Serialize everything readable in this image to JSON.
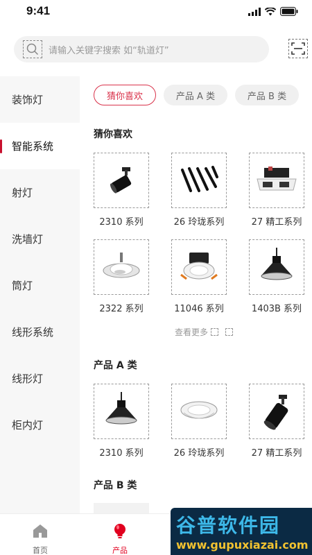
{
  "status_bar": {
    "time": "9:41"
  },
  "search": {
    "placeholder": "请输入关键字搜索 如“轨道灯”"
  },
  "sidebar": {
    "items": [
      {
        "label": "装饰灯"
      },
      {
        "label": "智能系统"
      },
      {
        "label": "射灯"
      },
      {
        "label": "洗墙灯"
      },
      {
        "label": "筒灯"
      },
      {
        "label": "线形系统"
      },
      {
        "label": "线形灯"
      },
      {
        "label": "柜内灯"
      }
    ],
    "active_index": 1
  },
  "chips": [
    {
      "label": "猜你喜欢"
    },
    {
      "label": "产品 A 类"
    },
    {
      "label": "产品 B 类"
    }
  ],
  "sections": {
    "recommend": {
      "title": "猜你喜欢",
      "products": [
        {
          "name": "2310 系列",
          "icon": "track-spotlight"
        },
        {
          "name": "26 玲珑系列",
          "icon": "linear-strip-lights"
        },
        {
          "name": "27 精工系列",
          "icon": "grille-downlight"
        },
        {
          "name": "2322 系列",
          "icon": "adjustable-downlight"
        },
        {
          "name": "11046 系列",
          "icon": "recessed-downlight"
        },
        {
          "name": "1403B 系列",
          "icon": "pendant-light"
        }
      ],
      "more_label": "查看更多"
    },
    "product_a": {
      "title": "产品 A 类",
      "products": [
        {
          "name": "2310 系列",
          "icon": "pendant-light"
        },
        {
          "name": "26 玲珑系列",
          "icon": "recessed-downlight"
        },
        {
          "name": "27 精工系列",
          "icon": "track-spotlight"
        }
      ]
    },
    "product_b": {
      "title": "产品 B 类"
    }
  },
  "tab_bar": {
    "items": [
      {
        "label": "首页",
        "icon": "home-icon"
      },
      {
        "label": "产品",
        "icon": "bulb-icon"
      }
    ],
    "active_index": 1,
    "active_color": "#e1001f"
  },
  "watermark": {
    "title": "谷普软件园",
    "url": "www.gupuxiazai.com"
  },
  "colors": {
    "accent": "#d9324a",
    "sidebar_bg": "#f7f7f7"
  }
}
